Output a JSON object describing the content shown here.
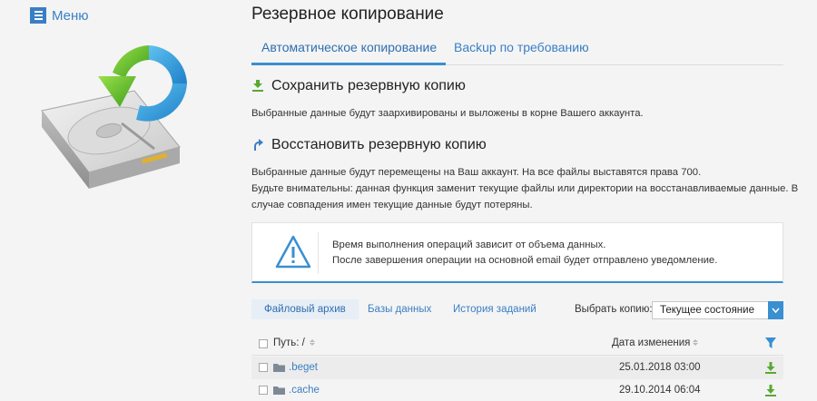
{
  "menu": {
    "label": "Меню"
  },
  "page": {
    "title": "Резервное копирование"
  },
  "tabs": [
    {
      "label": "Автоматическое копирование",
      "active": true
    },
    {
      "label": "Backup по требованию",
      "active": false
    }
  ],
  "save": {
    "title": "Сохранить резервную копию",
    "text": "Выбранные данные будут заархивированы и выложены в корне Вашего аккаунта."
  },
  "restore": {
    "title": "Восстановить резервную копию",
    "text_lines": [
      "Выбранные данные будут перемещены на Ваш аккаунт. На все файлы выставятся права 700.",
      "Будьте внимательны: данная функция заменит текущие файлы или директории на восстанавливаемые данные. В",
      "случае совпадения имен текущие данные будут потеряны."
    ]
  },
  "notice": {
    "lines": [
      "Время выполнения операций зависит от объема данных.",
      "После завершения операции на основной email будет отправлено уведомление."
    ]
  },
  "subtabs": [
    {
      "label": "Файловый архив",
      "active": true
    },
    {
      "label": "Базы данных",
      "active": false
    },
    {
      "label": "История заданий",
      "active": false
    }
  ],
  "select_copy": {
    "label": "Выбрать копию:",
    "value": "Текущее состояние"
  },
  "table": {
    "headers": {
      "path": "Путь: /",
      "date": "Дата изменения"
    },
    "rows": [
      {
        "name": ".beget",
        "date": "25.01.2018 03:00"
      },
      {
        "name": ".cache",
        "date": "29.10.2014 06:04"
      }
    ]
  },
  "colors": {
    "accent": "#3a8fd0",
    "link": "#3a7fc4",
    "download": "#5aa832"
  }
}
